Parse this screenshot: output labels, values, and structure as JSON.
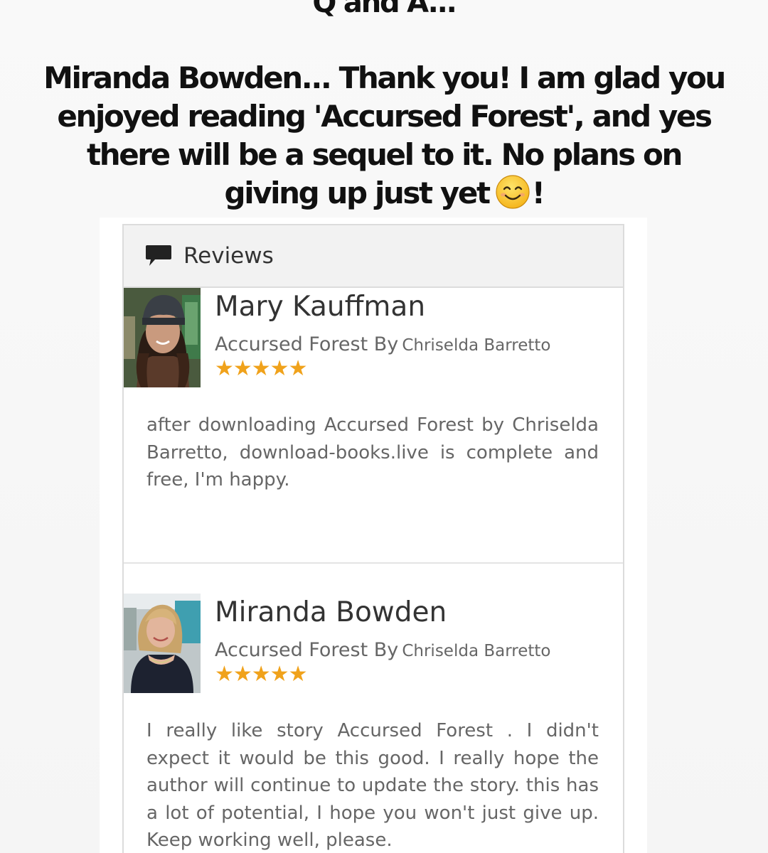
{
  "qa": {
    "heading": "Q and A...",
    "message": "Miranda Bowden... Thank you! I am glad you enjoyed reading 'Accursed Forest', and yes there will be a sequel to it. No plans on giving up just yet",
    "message_end": "!",
    "emoji_icon": "smiling-face-emoji"
  },
  "reviews": {
    "title": "Reviews",
    "icon": "comment-icon",
    "star_color": "#f0a21b",
    "items": [
      {
        "name": "Mary Kauffman",
        "book_prefix": "Accursed Forest By",
        "author": "Chriselda Barretto",
        "rating": 5,
        "stars": "★★★★★",
        "text": "after downloading Accursed Forest by Chriselda Barretto, download-books.live is complete and free, I'm happy."
      },
      {
        "name": "Miranda Bowden",
        "book_prefix": "Accursed Forest By",
        "author": "Chriselda Barretto",
        "rating": 5,
        "stars": "★★★★★",
        "text": "I really like story Accursed Forest . I didn't expect it would be this good. I really hope the author will continue to update the story. this has a lot of potential, I hope you won't just give up. Keep working well, please."
      }
    ]
  }
}
